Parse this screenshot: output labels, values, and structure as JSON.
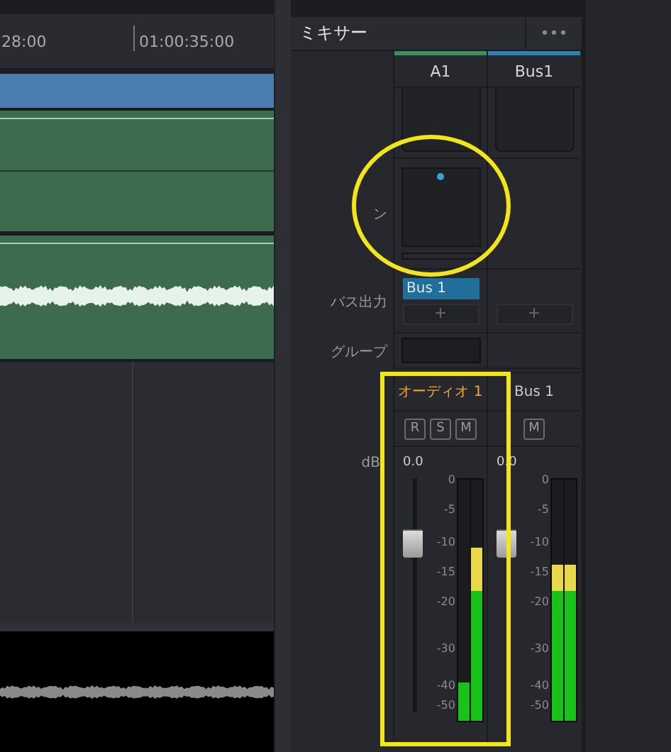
{
  "timeline": {
    "ruler": [
      "28:00",
      "01:00:35:00"
    ],
    "tracks": [
      {
        "kind": "video"
      },
      {
        "kind": "audio"
      },
      {
        "kind": "audio_wave"
      }
    ]
  },
  "mixer": {
    "title": "ミキサー",
    "menu": "•••",
    "labels": {
      "pan": "ン",
      "bus_output": "バス出力",
      "group": "グループ",
      "db": "dB"
    },
    "channels": [
      {
        "header": "A1",
        "color": "#3f8f5a",
        "pan": true,
        "bus_output": "Bus 1",
        "add": "+",
        "group": true,
        "name": "オーディオ 1",
        "selected": true,
        "buttons": [
          "R",
          "S",
          "M"
        ],
        "reading": "0.0",
        "fader": {
          "level": 0.73
        },
        "scale": [
          "0",
          "-5",
          "-10",
          "-15",
          "-20",
          "-30",
          "-40",
          "-50"
        ],
        "meters": [
          {
            "level": 0.16
          },
          {
            "level": 0.72
          }
        ]
      },
      {
        "header": "Bus1",
        "color": "#2f7fb0",
        "pan": false,
        "add": "+",
        "group": false,
        "name": "Bus 1",
        "selected": false,
        "buttons": [
          "M"
        ],
        "reading": "0.0",
        "fader": {
          "level": 0.73
        },
        "scale": [
          "0",
          "-5",
          "-10",
          "-15",
          "-20",
          "-30",
          "-40",
          "-50"
        ],
        "meters": [
          {
            "level": 0.65
          },
          {
            "level": 0.65
          }
        ]
      }
    ]
  },
  "annotations": [
    {
      "kind": "circle"
    },
    {
      "kind": "rect"
    }
  ]
}
